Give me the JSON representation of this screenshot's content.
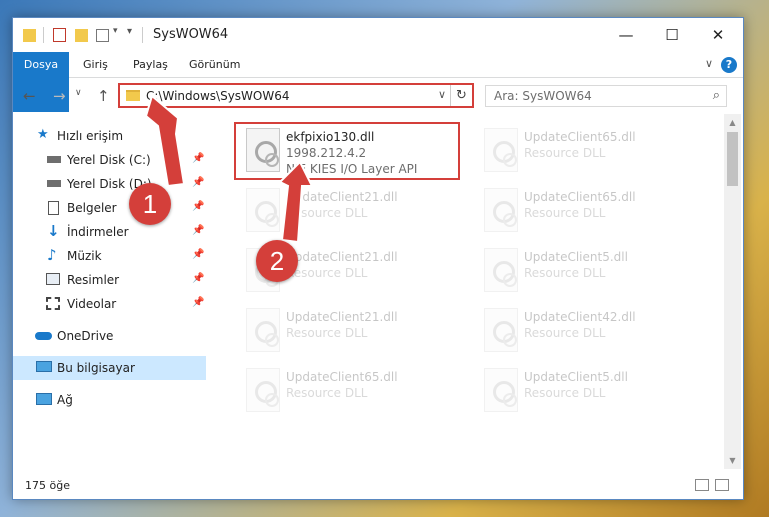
{
  "window": {
    "title": "SysWOW64"
  },
  "ribbon": {
    "tabs": [
      "Dosya",
      "Giriş",
      "Paylaş",
      "Görünüm"
    ],
    "help": "?"
  },
  "address": {
    "path": "C:\\Windows\\SysWOW64"
  },
  "search": {
    "placeholder": "Ara: SysWOW64"
  },
  "sidebar": {
    "items": [
      {
        "label": "Hızlı erişim"
      },
      {
        "label": "Yerel Disk (C:)"
      },
      {
        "label": "Yerel Disk (D:)"
      },
      {
        "label": "Belgeler"
      },
      {
        "label": "İndirmeler"
      },
      {
        "label": "Müzik"
      },
      {
        "label": "Resimler"
      },
      {
        "label": "Videolar"
      },
      {
        "label": "OneDrive"
      },
      {
        "label": "Bu bilgisayar"
      },
      {
        "label": "Ağ"
      }
    ]
  },
  "files": [
    {
      "name": "ekfpixio130.dll",
      "version": "1998.212.4.2",
      "desc": "NIE KIES I/O Layer API"
    },
    {
      "name": "UpdateClient65.dll",
      "type": "Resource DLL"
    },
    {
      "name": "UpdateClient21.dll",
      "type": "Resource DLL"
    },
    {
      "name": "UpdateClient65.dll",
      "type": "Resource DLL"
    },
    {
      "name": "UpdateClient21.dll",
      "type": "Resource DLL"
    },
    {
      "name": "UpdateClient5.dll",
      "type": "Resource DLL"
    },
    {
      "name": "UpdateClient21.dll",
      "type": "Resource DLL"
    },
    {
      "name": "UpdateClient42.dll",
      "type": "Resource DLL"
    },
    {
      "name": "UpdateClient65.dll",
      "type": "Resource DLL"
    },
    {
      "name": "UpdateClient5.dll",
      "type": "Resource DLL"
    }
  ],
  "status": {
    "count": "175 öğe"
  },
  "annotations": {
    "step1": "1",
    "step2": "2"
  },
  "colors": {
    "accent": "#1979ca",
    "highlight": "#d43f3a",
    "selected": "#cce8ff"
  }
}
